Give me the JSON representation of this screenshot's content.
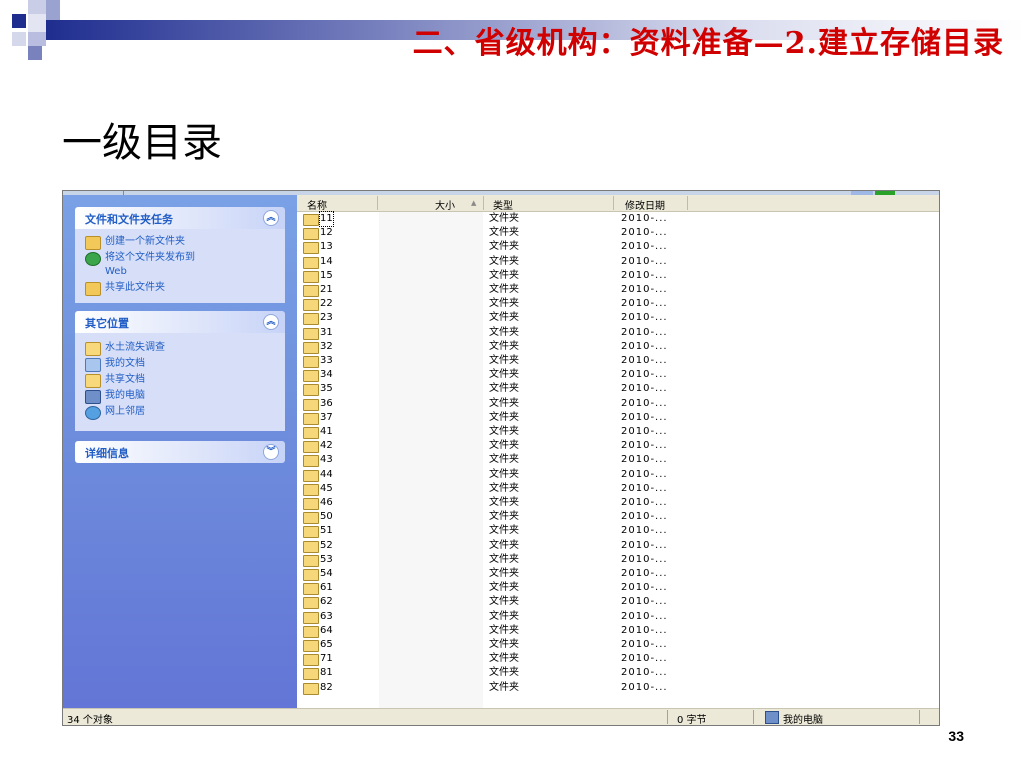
{
  "slide": {
    "title": "二、省级机构：资料准备—2.建立存储目录",
    "subtitle": "一级目录",
    "page_number": "33",
    "accent_color": "#d00000"
  },
  "taskpane": {
    "file_tasks": {
      "title": "文件和文件夹任务",
      "items": [
        {
          "label": "创建一个新文件夹",
          "icon": "new-folder-icon"
        },
        {
          "label": "将这个文件夹发布到\nWeb",
          "icon": "globe-icon"
        },
        {
          "label": "共享此文件夹",
          "icon": "share-folder-icon"
        }
      ]
    },
    "other_places": {
      "title": "其它位置",
      "items": [
        {
          "label": "水土流失调查",
          "icon": "folder-icon"
        },
        {
          "label": "我的文档",
          "icon": "my-documents-icon"
        },
        {
          "label": "共享文档",
          "icon": "shared-documents-icon"
        },
        {
          "label": "我的电脑",
          "icon": "my-computer-icon"
        },
        {
          "label": "网上邻居",
          "icon": "network-places-icon"
        }
      ]
    },
    "details": {
      "title": "详细信息"
    }
  },
  "filelist": {
    "columns": {
      "name": "名称",
      "size": "大小",
      "type": "类型",
      "modified": "修改日期"
    },
    "rows": [
      {
        "name": "11",
        "type": "文件夹",
        "date": "2010-..."
      },
      {
        "name": "12",
        "type": "文件夹",
        "date": "2010-..."
      },
      {
        "name": "13",
        "type": "文件夹",
        "date": "2010-..."
      },
      {
        "name": "14",
        "type": "文件夹",
        "date": "2010-..."
      },
      {
        "name": "15",
        "type": "文件夹",
        "date": "2010-..."
      },
      {
        "name": "21",
        "type": "文件夹",
        "date": "2010-..."
      },
      {
        "name": "22",
        "type": "文件夹",
        "date": "2010-..."
      },
      {
        "name": "23",
        "type": "文件夹",
        "date": "2010-..."
      },
      {
        "name": "31",
        "type": "文件夹",
        "date": "2010-..."
      },
      {
        "name": "32",
        "type": "文件夹",
        "date": "2010-..."
      },
      {
        "name": "33",
        "type": "文件夹",
        "date": "2010-..."
      },
      {
        "name": "34",
        "type": "文件夹",
        "date": "2010-..."
      },
      {
        "name": "35",
        "type": "文件夹",
        "date": "2010-..."
      },
      {
        "name": "36",
        "type": "文件夹",
        "date": "2010-..."
      },
      {
        "name": "37",
        "type": "文件夹",
        "date": "2010-..."
      },
      {
        "name": "41",
        "type": "文件夹",
        "date": "2010-..."
      },
      {
        "name": "42",
        "type": "文件夹",
        "date": "2010-..."
      },
      {
        "name": "43",
        "type": "文件夹",
        "date": "2010-..."
      },
      {
        "name": "44",
        "type": "文件夹",
        "date": "2010-..."
      },
      {
        "name": "45",
        "type": "文件夹",
        "date": "2010-..."
      },
      {
        "name": "46",
        "type": "文件夹",
        "date": "2010-..."
      },
      {
        "name": "50",
        "type": "文件夹",
        "date": "2010-..."
      },
      {
        "name": "51",
        "type": "文件夹",
        "date": "2010-..."
      },
      {
        "name": "52",
        "type": "文件夹",
        "date": "2010-..."
      },
      {
        "name": "53",
        "type": "文件夹",
        "date": "2010-..."
      },
      {
        "name": "54",
        "type": "文件夹",
        "date": "2010-..."
      },
      {
        "name": "61",
        "type": "文件夹",
        "date": "2010-..."
      },
      {
        "name": "62",
        "type": "文件夹",
        "date": "2010-..."
      },
      {
        "name": "63",
        "type": "文件夹",
        "date": "2010-..."
      },
      {
        "name": "64",
        "type": "文件夹",
        "date": "2010-..."
      },
      {
        "name": "65",
        "type": "文件夹",
        "date": "2010-..."
      },
      {
        "name": "71",
        "type": "文件夹",
        "date": "2010-..."
      },
      {
        "name": "81",
        "type": "文件夹",
        "date": "2010-..."
      },
      {
        "name": "82",
        "type": "文件夹",
        "date": "2010-..."
      }
    ]
  },
  "statusbar": {
    "object_count": "34 个对象",
    "size": "0 字节",
    "location": "我的电脑"
  }
}
